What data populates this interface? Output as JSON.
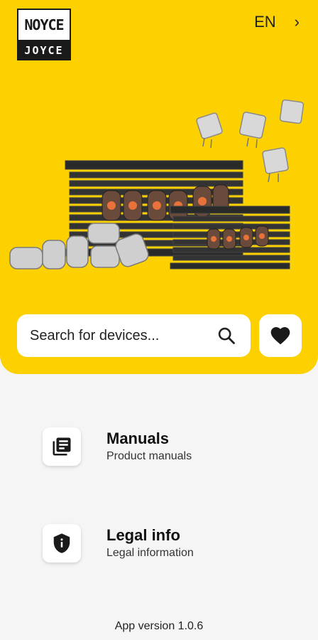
{
  "logo": {
    "top": "NOYCE",
    "bottom": "JOYCE"
  },
  "language": {
    "code": "EN",
    "chevron": "chevron-right-icon"
  },
  "search": {
    "placeholder": "Search for devices...",
    "icon": "search-icon"
  },
  "favorites": {
    "icon": "heart-icon"
  },
  "menu": [
    {
      "title": "Manuals",
      "subtitle": "Product manuals",
      "icon": "manuals-icon"
    },
    {
      "title": "Legal info",
      "subtitle": "Legal information",
      "icon": "shield-info-icon"
    }
  ],
  "version": "App version 1.0.6",
  "colors": {
    "accent": "#fdd000",
    "background": "#f5f5f5",
    "text": "#111111"
  }
}
